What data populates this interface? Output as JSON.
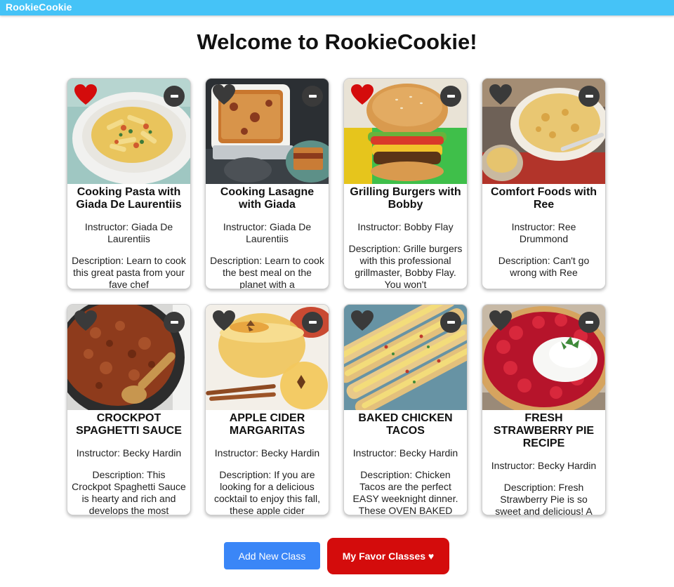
{
  "window": {
    "title": "RookieCookie"
  },
  "header": {
    "title": "Welcome to RookieCookie!"
  },
  "classes": [
    {
      "title": "Cooking Pasta with Giada De Laurentiis",
      "instructor": "Instructor: Giada De Laurentiis",
      "description": "Description: Learn to cook this great pasta from your fave chef",
      "favorited": true,
      "image": "pasta-bowl"
    },
    {
      "title": "Cooking Lasagne with Giada",
      "instructor": "Instructor: Giada De Laurentiis",
      "description": "Description: Learn to cook the best meal on the planet with a",
      "favorited": false,
      "image": "lasagne-dish"
    },
    {
      "title": "Grilling Burgers with Bobby",
      "instructor": "Instructor: Bobby Flay",
      "description": "Description: Grille burgers with this professional grillmaster, Bobby Flay. You won't",
      "favorited": true,
      "image": "burger"
    },
    {
      "title": "Comfort Foods with Ree",
      "instructor": "Instructor: Ree Drummond",
      "description": "Description: Can't go wrong with Ree",
      "favorited": false,
      "image": "casserole"
    },
    {
      "title": "CROCKPOT SPAGHETTI SAUCE",
      "instructor": "Instructor: Becky Hardin",
      "description": "Description: This Crockpot Spaghetti Sauce is hearty and rich and develops the most",
      "favorited": false,
      "image": "spaghetti-sauce"
    },
    {
      "title": "APPLE CIDER MARGARITAS",
      "instructor": "Instructor: Becky Hardin",
      "description": "Description: If you are looking for a delicious cocktail to enjoy this fall, these apple cider",
      "favorited": false,
      "image": "margaritas"
    },
    {
      "title": "BAKED CHICKEN TACOS",
      "instructor": "Instructor: Becky Hardin",
      "description": "Description: Chicken Tacos are the perfect EASY weeknight dinner. These OVEN BAKED",
      "favorited": false,
      "image": "tacos"
    },
    {
      "title": "FRESH STRAWBERRY PIE RECIPE",
      "instructor": "Instructor: Becky Hardin",
      "description": "Description: Fresh Strawberry Pie is so sweet and delicious! A",
      "favorited": false,
      "image": "strawberry-pie"
    }
  ],
  "actions": {
    "add_label": "Add New Class",
    "favorites_label": "My Favor Classes ♥"
  },
  "colors": {
    "titlebar": "#45c3f7",
    "heart_active": "#d40c0c",
    "heart_inactive": "#3a3a3a",
    "add_button": "#3a86f7",
    "favorites_button": "#d40c0c"
  }
}
